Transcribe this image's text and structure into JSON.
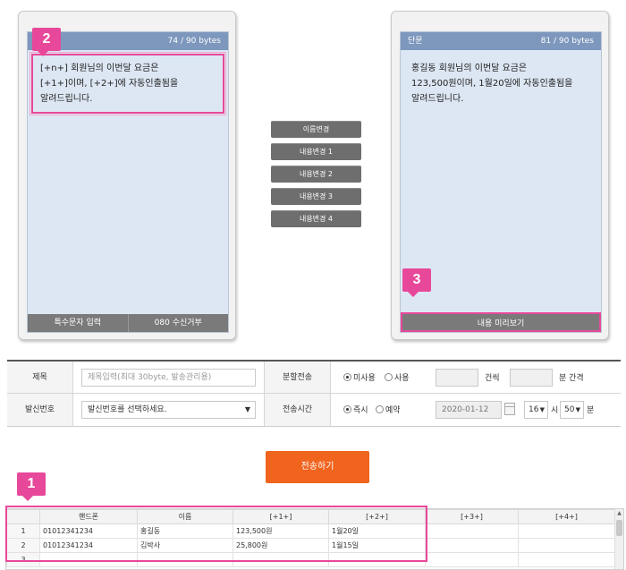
{
  "colors": {
    "accent_pink": "#e8489a",
    "send_orange": "#f0641e",
    "screen_head": "#7d97bd",
    "screen_bg": "#dde7f3",
    "button_gray": "#6e6e6e"
  },
  "left_phone": {
    "badge": "2",
    "bytes": "74 / 90 bytes",
    "message_lines": [
      "[+n+] 회원님의 이번달 요금은",
      "[+1+]이며, [+2+]에 자동인출됨을",
      "알려드립니다."
    ],
    "footer_buttons": [
      "특수문자 입력",
      "080 수신거부"
    ]
  },
  "right_phone": {
    "kind": "단문",
    "bytes": "81 / 90 bytes",
    "message_lines": [
      "홍길동 회원님의 이번달 요금은",
      "123,500원이며, 1월20일에 자동인출됨을",
      "알려드립니다."
    ],
    "badge": "3",
    "preview_button": "내용 미리보기"
  },
  "middle_buttons": [
    "이름변경",
    "내용변경 1",
    "내용변경 2",
    "내용변경 3",
    "내용변경 4"
  ],
  "form": {
    "title_label": "제목",
    "title_placeholder": "제목입력(최대 30byte, 발송관리용)",
    "split_label": "분할전송",
    "split_options": [
      "미사용",
      "사용"
    ],
    "count_unit": "건씩",
    "interval_unit": "분 간격",
    "sender_label": "발신번호",
    "sender_select": "발신번호를 선택하세요.",
    "time_label": "전송시간",
    "time_options": [
      "즉시",
      "예약"
    ],
    "date_value": "2020-01-12",
    "hour_value": "16",
    "hour_unit": "시",
    "minute_value": "50",
    "minute_unit": "분"
  },
  "send_button": "전송하기",
  "grid": {
    "badge": "1",
    "columns": [
      "핸드폰",
      "이름",
      "[+1+]",
      "[+2+]",
      "[+3+]",
      "[+4+]"
    ],
    "rows": [
      {
        "num": "1",
        "phone": "01012341234",
        "name": "홍길동",
        "v1": "123,500원",
        "v2": "1월20일",
        "v3": "",
        "v4": ""
      },
      {
        "num": "2",
        "phone": "01012341234",
        "name": "김박사",
        "v1": "25,800원",
        "v2": "1월15일",
        "v3": "",
        "v4": ""
      },
      {
        "num": "3",
        "phone": "",
        "name": "",
        "v1": "",
        "v2": "",
        "v3": "",
        "v4": ""
      }
    ]
  }
}
